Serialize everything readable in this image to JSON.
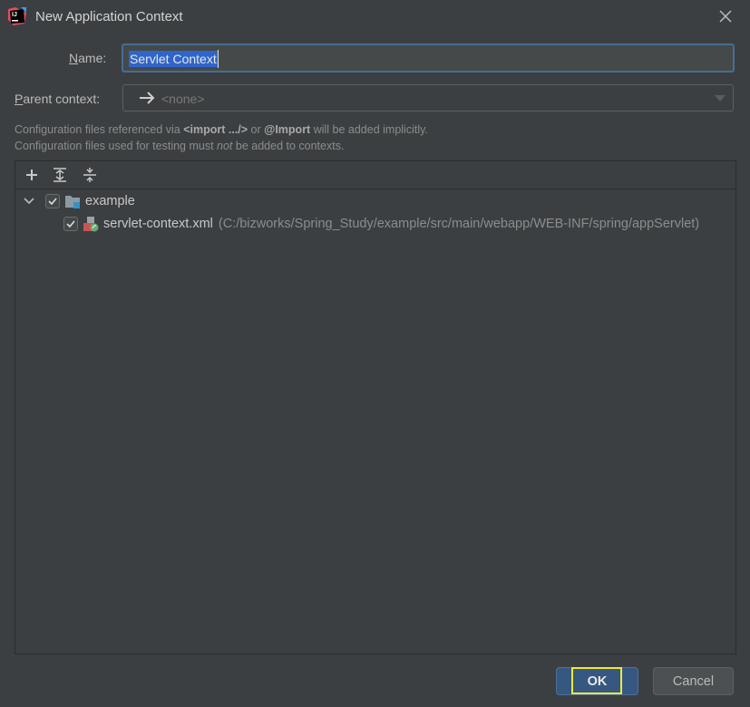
{
  "window": {
    "title": "New Application Context",
    "app_icon": "intellij-idea-icon",
    "close_icon": "close-icon"
  },
  "form": {
    "name_label_mnemonic": "N",
    "name_label_rest": "ame:",
    "name_value": "Servlet Context",
    "parent_label_mnemonic": "P",
    "parent_label_rest": "arent context:",
    "parent_value": "<none>",
    "parent_icon": "arrow-right-icon"
  },
  "info": {
    "line1_a": "Configuration files referenced via ",
    "line1_b": "<import .../>",
    "line1_c": " or ",
    "line1_d": "@Import",
    "line1_e": " will be added implicitly.",
    "line2_a": "Configuration files used for testing must ",
    "line2_b": "not",
    "line2_c": " be added to contexts."
  },
  "toolbar": {
    "add_icon": "plus-icon",
    "expand_icon": "expand-all-icon",
    "collapse_icon": "collapse-all-icon"
  },
  "tree": {
    "root": {
      "label": "example",
      "checked": true,
      "expanded": true,
      "icon": "folder-icon"
    },
    "children": [
      {
        "label": "servlet-context.xml",
        "path": "(C:/bizworks/Spring_Study/example/src/main/webapp/WEB-INF/spring/appServlet)",
        "checked": true,
        "icon": "spring-xml-icon"
      }
    ]
  },
  "buttons": {
    "ok": "OK",
    "cancel": "Cancel"
  },
  "colors": {
    "background": "#3c3f41",
    "accent": "#365880",
    "selection": "#2f65ca",
    "highlight": "#f0e836"
  }
}
